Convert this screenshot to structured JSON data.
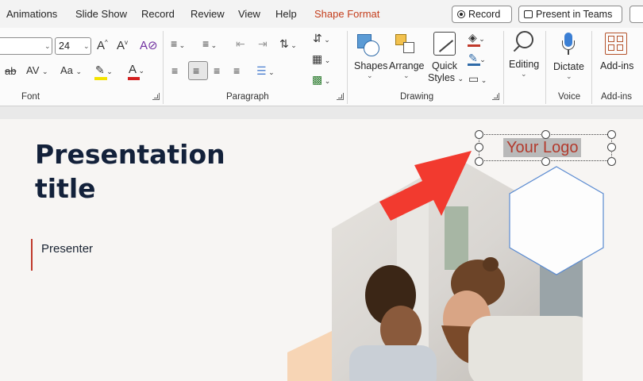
{
  "menu": {
    "tabs": [
      "Animations",
      "Slide Show",
      "Record",
      "Review",
      "View",
      "Help",
      "Shape Format"
    ],
    "record_button": "Record",
    "teams_button": "Present in Teams"
  },
  "ribbon": {
    "font": {
      "size_value": "24",
      "group_label": "Font",
      "grow_label": "A",
      "shrink_label": "A",
      "strike_label": "ab",
      "spacing_label": "AV",
      "case_label": "Aa"
    },
    "paragraph": {
      "group_label": "Paragraph"
    },
    "drawing": {
      "group_label": "Drawing",
      "shapes_label": "Shapes",
      "arrange_label": "Arrange",
      "quick_styles_label_1": "Quick",
      "quick_styles_label_2": "Styles"
    },
    "voice": {
      "editing_label": "Editing",
      "dictate_label": "Dictate",
      "group_label": "Voice"
    },
    "addins": {
      "button_label": "Add-ins",
      "group_label": "Add-ins"
    }
  },
  "slide": {
    "title": "Presentation title",
    "presenter": "Presenter",
    "logo_placeholder": "Your Logo"
  },
  "colors": {
    "accent_tab": "#c43e1c",
    "arrow": "#f23a2f",
    "title_text": "#13213a",
    "logo_text": "#b33b2e",
    "hexagon_outline": "#5b8bd1",
    "peach_hexagon": "#f7d5b5"
  }
}
